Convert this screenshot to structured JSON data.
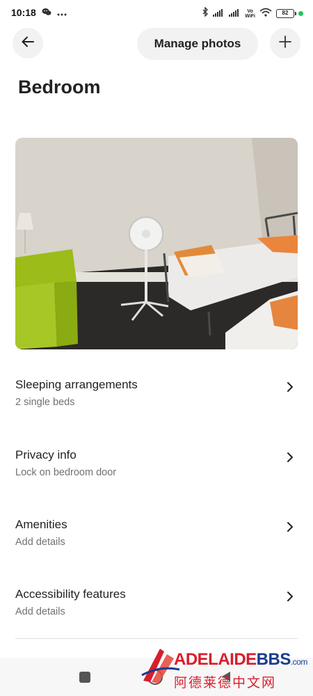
{
  "status_bar": {
    "time": "10:18",
    "battery": "82",
    "vowifi_top": "Vo",
    "vowifi_bottom": "WiFi",
    "icons": [
      "wechat-icon",
      "more-dots-icon",
      "bluetooth-icon",
      "signal-icon",
      "signal-icon",
      "vowifi-icon",
      "wifi-icon",
      "battery-icon"
    ]
  },
  "header": {
    "back_icon": "arrow-left-icon",
    "manage_label": "Manage photos",
    "add_icon": "plus-icon"
  },
  "page": {
    "title": "Bedroom"
  },
  "photo": {
    "subject": "room-photo"
  },
  "rows": [
    {
      "title": "Sleeping arrangements",
      "subtitle": "2 single beds"
    },
    {
      "title": "Privacy info",
      "subtitle": "Lock on bedroom door"
    },
    {
      "title": "Amenities",
      "subtitle": "Add details"
    },
    {
      "title": "Accessibility features",
      "subtitle": "Add details"
    }
  ],
  "watermark": {
    "brand_a": "ADELAIDE",
    "brand_b": "BBS",
    "brand_suffix": ".com",
    "chinese": "阿德莱德中文网"
  },
  "colors": {
    "accent_text": "#222222",
    "muted_text": "#717171",
    "button_bg": "#f2f2f2",
    "divider": "#dddddd"
  }
}
